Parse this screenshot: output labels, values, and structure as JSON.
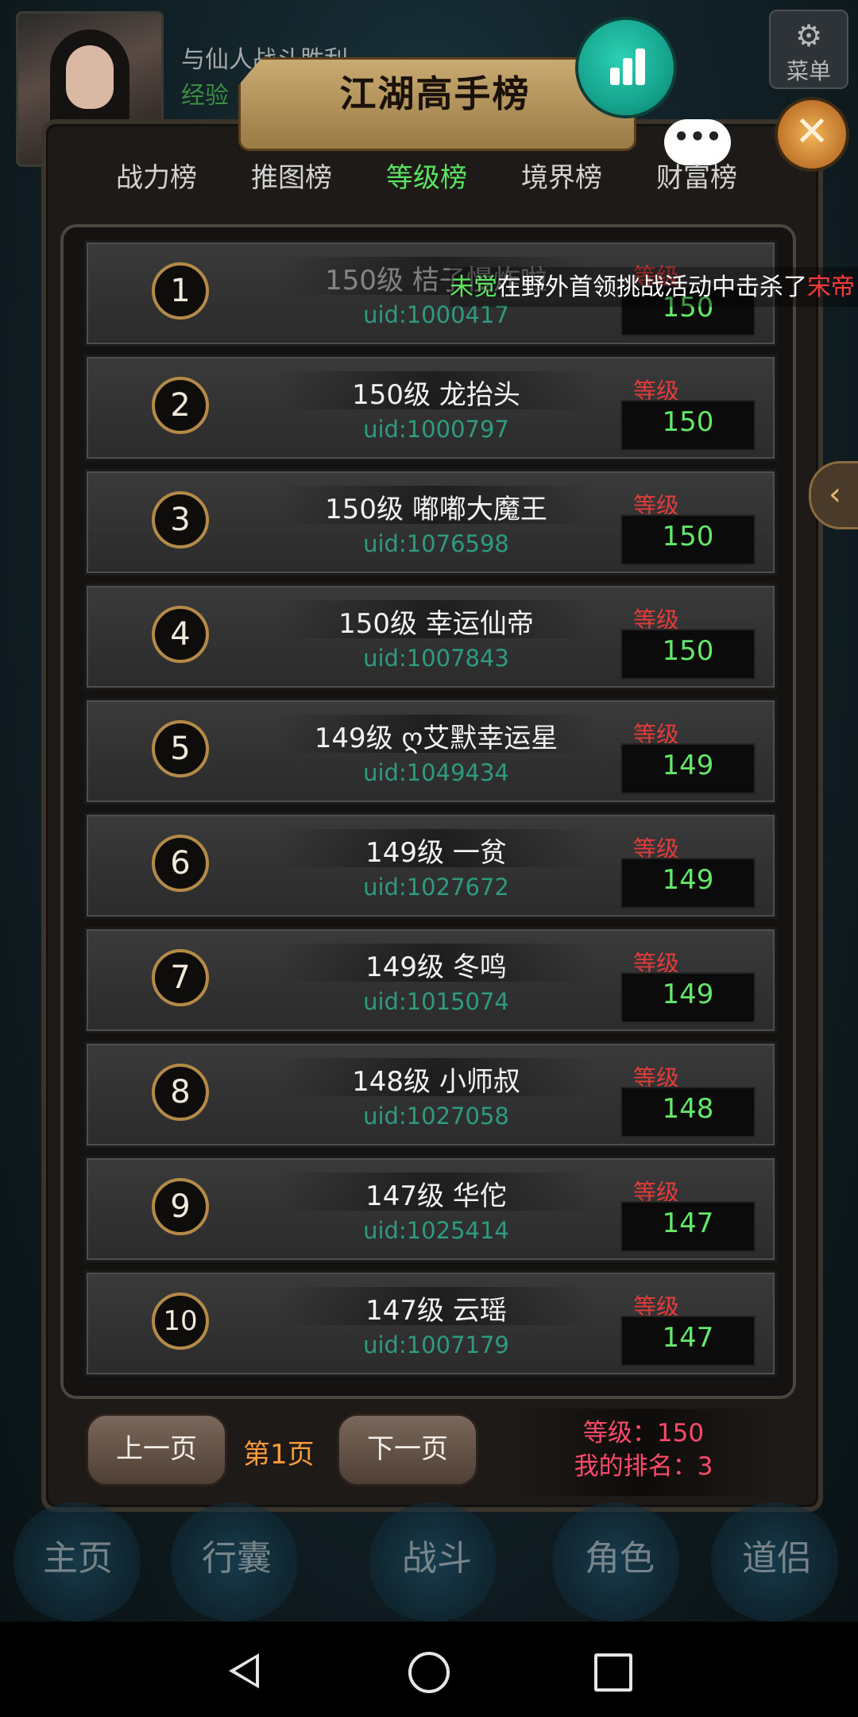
{
  "hud": {
    "message": "与仙人战斗胜利",
    "exp_label": "经验",
    "menu_label": "菜单"
  },
  "panel": {
    "title": "江湖高手榜",
    "close_symbol": "✕",
    "chat_symbol": "•••",
    "tabs": [
      {
        "label": "战力榜",
        "active": false
      },
      {
        "label": "推图榜",
        "active": false
      },
      {
        "label": "等级榜",
        "active": true
      },
      {
        "label": "境界榜",
        "active": false
      },
      {
        "label": "财富榜",
        "active": false
      }
    ],
    "level_label": "等级",
    "rows": [
      {
        "rank": "1",
        "name": "150级 桔子慢炸啦",
        "uid": "uid:1000417",
        "level": "150"
      },
      {
        "rank": "2",
        "name": "150级 龙抬头",
        "uid": "uid:1000797",
        "level": "150"
      },
      {
        "rank": "3",
        "name": "150级 嘟嘟大魔王",
        "uid": "uid:1076598",
        "level": "150"
      },
      {
        "rank": "4",
        "name": "150级 幸运仙帝",
        "uid": "uid:1007843",
        "level": "150"
      },
      {
        "rank": "5",
        "name": "149级 ღ艾默幸运星",
        "uid": "uid:1049434",
        "level": "149"
      },
      {
        "rank": "6",
        "name": "149级 一贫",
        "uid": "uid:1027672",
        "level": "149"
      },
      {
        "rank": "7",
        "name": "149级 冬鸣",
        "uid": "uid:1015074",
        "level": "149"
      },
      {
        "rank": "8",
        "name": "148级 小师叔",
        "uid": "uid:1027058",
        "level": "148"
      },
      {
        "rank": "9",
        "name": "147级 华佗",
        "uid": "uid:1025414",
        "level": "147"
      },
      {
        "rank": "10",
        "name": "147级 云瑶",
        "uid": "uid:1007179",
        "level": "147"
      }
    ],
    "broadcast": {
      "player": "未觉",
      "text": "在野外首领挑战活动中击杀了",
      "target": "宋帝"
    },
    "pagination": {
      "prev_label": "上一页",
      "page_label": "第1页",
      "next_label": "下一页"
    },
    "my_info": {
      "level_text": "等级：150",
      "rank_text": "我的排名：3"
    }
  },
  "game_nav": [
    "主页",
    "行囊",
    "战斗",
    "角色",
    "道侣"
  ],
  "android_nav": {
    "back_icon": "back-icon",
    "home_icon": "home-icon",
    "recent_icon": "recent-apps-icon"
  }
}
